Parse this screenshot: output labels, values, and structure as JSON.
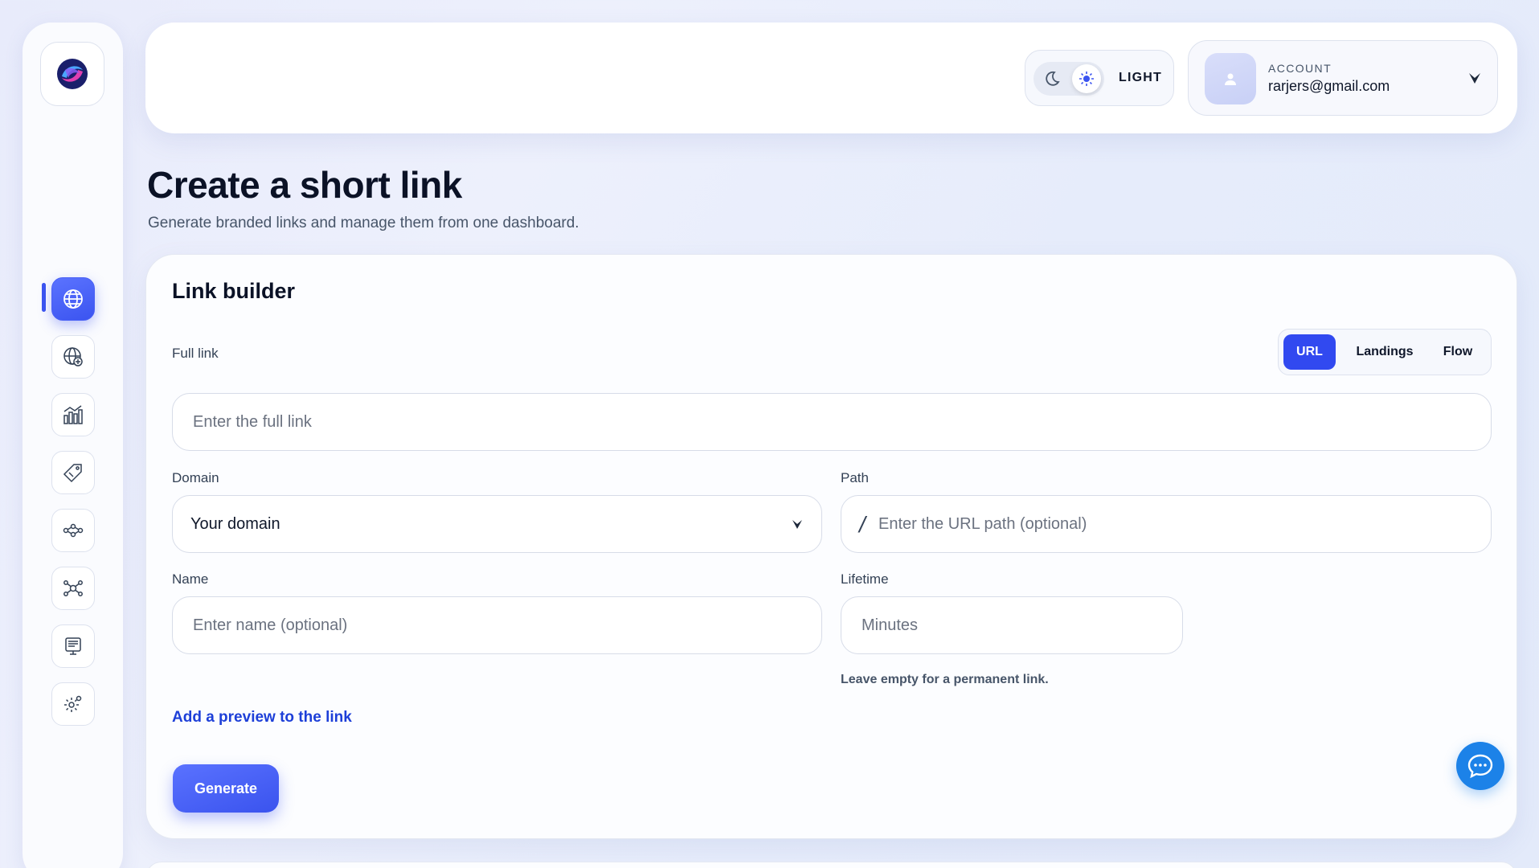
{
  "sidebar": {
    "logo_icon": "app-logo-swirl",
    "items": [
      {
        "name": "links",
        "icon": "globe-icon",
        "active": true
      },
      {
        "name": "domains",
        "icon": "globe-plus-icon",
        "active": false
      },
      {
        "name": "analytics",
        "icon": "bar-chart-icon",
        "active": false
      },
      {
        "name": "campaigns",
        "icon": "tag-icon",
        "active": false
      },
      {
        "name": "flows",
        "icon": "flow-icon",
        "active": false
      },
      {
        "name": "integrations",
        "icon": "network-icon",
        "active": false
      },
      {
        "name": "billing",
        "icon": "monitor-icon",
        "active": false
      },
      {
        "name": "settings",
        "icon": "gear-icon",
        "active": false
      }
    ]
  },
  "header": {
    "theme_label": "LIGHT",
    "account_label": "ACCOUNT",
    "account_email": "rarjers@gmail.com"
  },
  "page": {
    "title": "Create a short link",
    "subtitle": "Generate branded links and manage them from one dashboard."
  },
  "builder": {
    "title": "Link builder",
    "full_link_label": "Full link",
    "tabs": [
      "URL",
      "Landings",
      "Flow"
    ],
    "active_tab": "URL",
    "full_link_placeholder": "Enter the full link",
    "domain_label": "Domain",
    "domain_value": "Your domain",
    "path_label": "Path",
    "path_prefix": "/",
    "path_placeholder": "Enter the URL path (optional)",
    "name_label": "Name",
    "name_placeholder": "Enter name (optional)",
    "lifetime_label": "Lifetime",
    "lifetime_placeholder": "Minutes",
    "lifetime_hint": "Leave empty for a permanent link.",
    "preview_link": "Add a preview to the link",
    "generate_label": "Generate"
  },
  "colors": {
    "accent": "#3b54f0",
    "link": "#1d3fd8",
    "chat": "#1c82e8"
  }
}
